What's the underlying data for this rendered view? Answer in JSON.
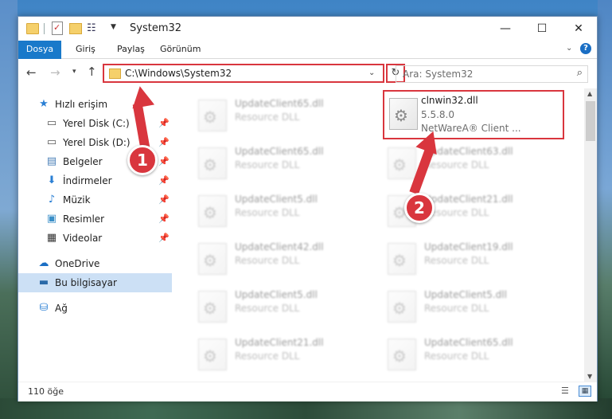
{
  "window": {
    "title": "System32"
  },
  "ribbon": {
    "tabs": [
      "Dosya",
      "Giriş",
      "Paylaş",
      "Görünüm"
    ]
  },
  "nav": {
    "address": "C:\\Windows\\System32",
    "search_placeholder": "Ara: System32"
  },
  "sidebar": {
    "items": [
      {
        "label": "Hızlı erişim",
        "icon": "star-icon",
        "pinned": false
      },
      {
        "label": "Yerel Disk (C:)",
        "icon": "drive-icon",
        "pinned": true
      },
      {
        "label": "Yerel Disk (D:)",
        "icon": "drive-icon",
        "pinned": true
      },
      {
        "label": "Belgeler",
        "icon": "documents-icon",
        "pinned": true
      },
      {
        "label": "İndirmeler",
        "icon": "download-icon",
        "pinned": true
      },
      {
        "label": "Müzik",
        "icon": "music-icon",
        "pinned": true
      },
      {
        "label": "Resimler",
        "icon": "pictures-icon",
        "pinned": true
      },
      {
        "label": "Videolar",
        "icon": "video-icon",
        "pinned": true
      },
      {
        "label": "OneDrive",
        "icon": "cloud-icon",
        "pinned": false
      },
      {
        "label": "Bu bilgisayar",
        "icon": "computer-icon",
        "pinned": false,
        "selected": true
      },
      {
        "label": "Ağ",
        "icon": "network-icon",
        "pinned": false
      }
    ]
  },
  "files": {
    "highlighted": {
      "name": "clnwin32.dll",
      "version": "5.5.8.0",
      "company": "NetWareA® Client ..."
    },
    "left_column": [
      {
        "name": "UpdateClient65.dll",
        "type": "Resource DLL"
      },
      {
        "name": "UpdateClient65.dll",
        "type": "Resource DLL"
      },
      {
        "name": "UpdateClient5.dll",
        "type": "Resource DLL"
      },
      {
        "name": "UpdateClient42.dll",
        "type": "Resource DLL"
      },
      {
        "name": "UpdateClient5.dll",
        "type": "Resource DLL"
      },
      {
        "name": "UpdateClient21.dll",
        "type": "Resource DLL"
      }
    ],
    "right_column": [
      {
        "name": "UpdateClient63.dll",
        "type": "Resource DLL"
      },
      {
        "name": "UpdateClient21.dll",
        "type": "Resource DLL"
      },
      {
        "name": "UpdateClient19.dll",
        "type": "Resource DLL"
      },
      {
        "name": "UpdateClient5.dll",
        "type": "Resource DLL"
      },
      {
        "name": "UpdateClient65.dll",
        "type": "Resource DLL"
      }
    ]
  },
  "status": {
    "count": "110 öğe"
  },
  "callouts": {
    "step1": "1",
    "step2": "2"
  },
  "colors": {
    "accent": "#1979ca",
    "highlight": "#d9363e"
  }
}
